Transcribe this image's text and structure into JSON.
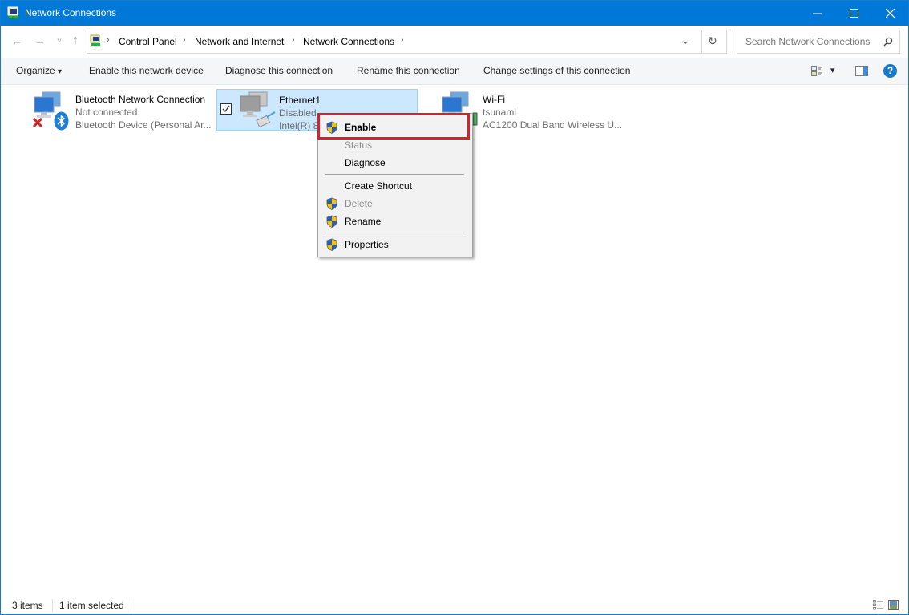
{
  "window": {
    "title": "Network Connections",
    "controls": {
      "minimize": "—",
      "maximize": "☐",
      "close": "✕"
    }
  },
  "nav": {
    "back_icon": "←",
    "forward_icon": "→",
    "recent_icon": "˅",
    "up_icon": "↑"
  },
  "address": {
    "breadcrumbs": [
      "Control Panel",
      "Network and Internet",
      "Network Connections"
    ],
    "separator": "›",
    "dropdown_icon": "⌄",
    "refresh_icon": "↻"
  },
  "search": {
    "placeholder": "Search Network Connections",
    "icon": "⚲"
  },
  "commandbar": {
    "organize": "Organize",
    "organize_arrow": "▾",
    "commands": [
      "Enable this network device",
      "Diagnose this connection",
      "Rename this connection",
      "Change settings of this connection"
    ],
    "view_arrow": "▾",
    "help": "?"
  },
  "connections": [
    {
      "name": "Bluetooth Network Connection",
      "status": "Not connected",
      "device": "Bluetooth Device (Personal Ar...",
      "selected": false
    },
    {
      "name": "Ethernet1",
      "status": "Disabled",
      "device": "Intel(R) 8",
      "selected": true
    },
    {
      "name": "Wi-Fi",
      "status": "tsunami",
      "device": "AC1200  Dual Band Wireless U...",
      "selected": false
    }
  ],
  "context_menu": {
    "items": [
      {
        "label": "Enable",
        "shield": true,
        "disabled": false,
        "bold": true
      },
      {
        "label": "Status",
        "shield": false,
        "disabled": true,
        "bold": false
      },
      {
        "label": "Diagnose",
        "shield": false,
        "disabled": false,
        "bold": false
      },
      {
        "label": "Create Shortcut",
        "shield": false,
        "disabled": false,
        "bold": false
      },
      {
        "label": "Delete",
        "shield": true,
        "disabled": true,
        "bold": false
      },
      {
        "label": "Rename",
        "shield": true,
        "disabled": false,
        "bold": false
      },
      {
        "label": "Properties",
        "shield": true,
        "disabled": false,
        "bold": false
      }
    ]
  },
  "statusbar": {
    "item_count": "3 items",
    "selection": "1 item selected"
  },
  "colors": {
    "titlebar": "#0078d7",
    "selection": "#cce8ff",
    "highlight_box": "#d6202a",
    "help_icon": "#1979ca"
  }
}
